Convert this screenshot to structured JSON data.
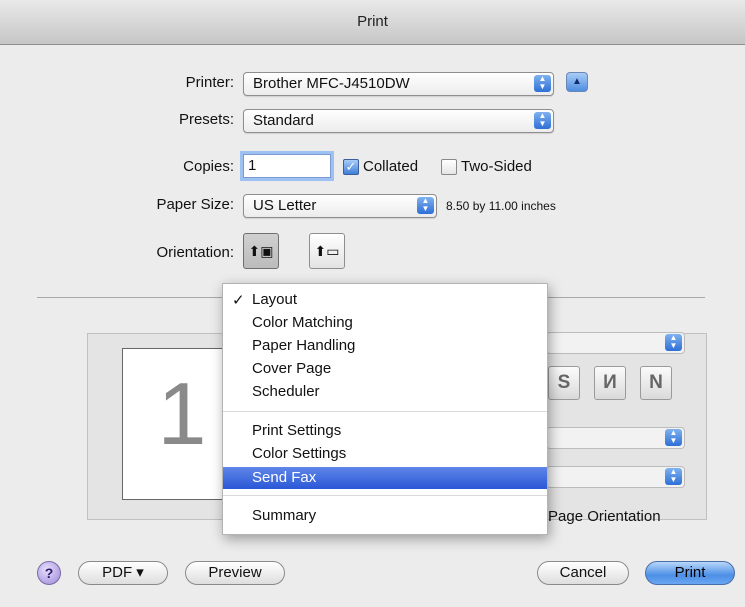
{
  "window": {
    "title": "Print"
  },
  "printer": {
    "label": "Printer:",
    "value": "Brother MFC-J4510DW"
  },
  "presets": {
    "label": "Presets:",
    "value": "Standard"
  },
  "copies": {
    "label": "Copies:",
    "value": "1",
    "collated_label": "Collated",
    "collated_checked": true,
    "two_sided_label": "Two-Sided",
    "two_sided_checked": false
  },
  "paper_size": {
    "label": "Paper Size:",
    "value": "US Letter",
    "dimensions": "8.50 by 11.00 inches"
  },
  "orientation": {
    "label": "Orientation:",
    "selected": "portrait"
  },
  "preview": {
    "page_number": "1"
  },
  "layout_panel": {
    "page_orientation_label": "Page Orientation"
  },
  "menu": {
    "items": [
      {
        "label": "Layout",
        "checked": true
      },
      {
        "label": "Color Matching"
      },
      {
        "label": "Paper Handling"
      },
      {
        "label": "Cover Page"
      },
      {
        "label": "Scheduler"
      },
      {
        "label": "Print Settings"
      },
      {
        "label": "Color Settings"
      },
      {
        "label": "Send Fax",
        "highlighted": true
      },
      {
        "label": "Summary"
      }
    ],
    "checkmark": "✓"
  },
  "footer": {
    "help": "?",
    "pdf_label": "PDF ▾",
    "preview_label": "Preview",
    "cancel_label": "Cancel",
    "print_label": "Print"
  },
  "icons": {
    "portrait": "portrait-orientation-icon",
    "landscape": "landscape-orientation-icon"
  },
  "colors": {
    "highlight": "#2a57d6",
    "default_button": "#4c8fe6",
    "help": "#9b86d6"
  }
}
